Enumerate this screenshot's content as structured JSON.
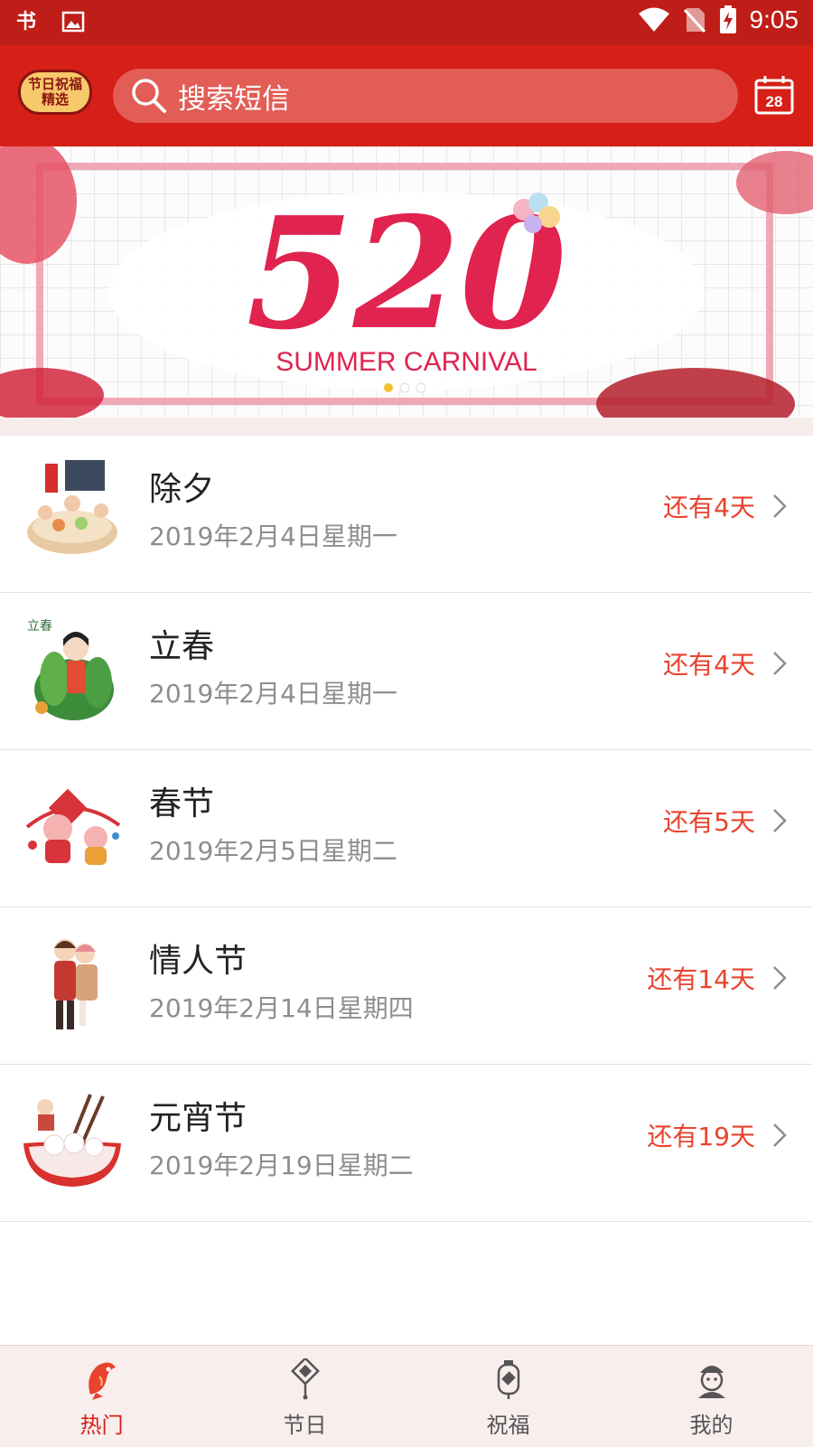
{
  "status_bar": {
    "app_mark": "书",
    "time": "9:05"
  },
  "header": {
    "logo_text": [
      "节日祝福",
      "精选"
    ],
    "search_placeholder": "搜索短信",
    "calendar_day": "28"
  },
  "banner": {
    "title_number": "520",
    "subtitle": "SUMMER CARNIVAL",
    "active_dot": 0,
    "dot_count": 3
  },
  "festivals": [
    {
      "name": "除夕",
      "date": "2019年2月4日星期一",
      "remaining": "还有4天"
    },
    {
      "name": "立春",
      "date": "2019年2月4日星期一",
      "remaining": "还有4天",
      "thumb_caption": "立春"
    },
    {
      "name": "春节",
      "date": "2019年2月5日星期二",
      "remaining": "还有5天"
    },
    {
      "name": "情人节",
      "date": "2019年2月14日星期四",
      "remaining": "还有14天"
    },
    {
      "name": "元宵节",
      "date": "2019年2月19日星期二",
      "remaining": "还有19天"
    }
  ],
  "tabs": [
    {
      "label": "热门",
      "icon": "fish-icon",
      "active": true
    },
    {
      "label": "节日",
      "icon": "knot-icon",
      "active": false
    },
    {
      "label": "祝福",
      "icon": "lantern-icon",
      "active": false
    },
    {
      "label": "我的",
      "icon": "person-icon",
      "active": false
    }
  ],
  "colors": {
    "primary": "#d61f16",
    "status_bar": "#bf1d17",
    "accent": "#e8432e",
    "banner_pink": "#e0234f"
  }
}
